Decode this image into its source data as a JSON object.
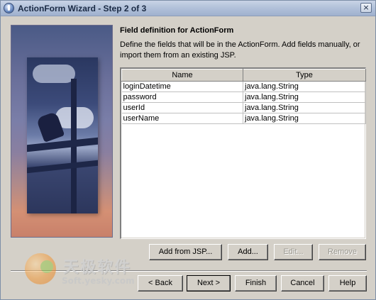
{
  "window": {
    "title": "ActionForm Wizard - Step 2 of 3",
    "close_label": "×"
  },
  "page": {
    "heading": "Field definition for ActionForm",
    "description": "Define the fields that will be in the ActionForm. Add fields manually, or import them from an existing JSP."
  },
  "table": {
    "columns": [
      "Name",
      "Type"
    ],
    "rows": [
      {
        "name": "loginDatetime",
        "type": "java.lang.String"
      },
      {
        "name": "password",
        "type": "java.lang.String"
      },
      {
        "name": "userId",
        "type": "java.lang.String"
      },
      {
        "name": "userName",
        "type": "java.lang.String"
      }
    ]
  },
  "table_buttons": {
    "add_from_jsp": {
      "label": "Add from JSP...",
      "enabled": true
    },
    "add": {
      "label": "Add...",
      "enabled": true
    },
    "edit": {
      "label": "Edit...",
      "enabled": false
    },
    "remove": {
      "label": "Remove",
      "enabled": false
    }
  },
  "nav_buttons": {
    "back": {
      "label": "< Back",
      "enabled": true
    },
    "next": {
      "label": "Next >",
      "enabled": true,
      "default": true
    },
    "finish": {
      "label": "Finish",
      "enabled": true
    },
    "cancel": {
      "label": "Cancel",
      "enabled": true
    },
    "help": {
      "label": "Help",
      "enabled": true
    }
  },
  "watermark": {
    "chinese_text": "天极软件",
    "url": "Soft.yesky.com"
  },
  "colors": {
    "dialog_bg": "#d4d0c8",
    "titlebar": "#b3c2da",
    "disabled_text": "#9a9890"
  }
}
